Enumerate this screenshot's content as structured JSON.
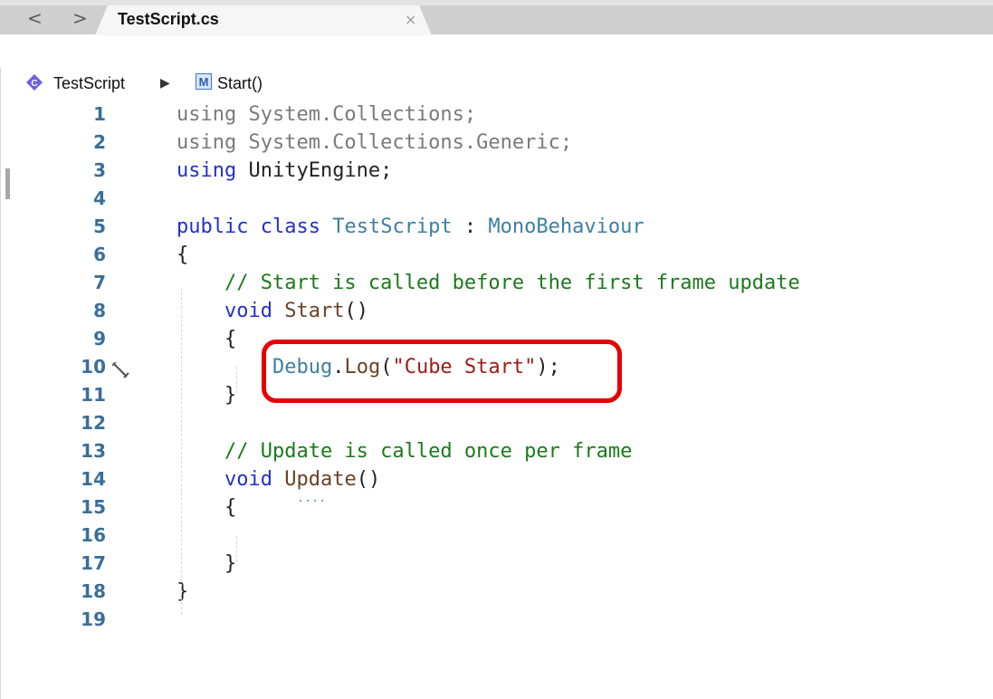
{
  "navigation": {
    "back_glyph": "<",
    "forward_glyph": ">"
  },
  "tab": {
    "title": "TestScript.cs",
    "close_glyph": "×"
  },
  "breadcrumb": {
    "class_name": "TestScript",
    "separator": "▶",
    "method_badge": "M",
    "method_name": "Start()",
    "class_icon": "class-diamond-icon",
    "method_icon": "method-icon"
  },
  "editor": {
    "line_numbers": [
      "1",
      "2",
      "3",
      "4",
      "5",
      "6",
      "7",
      "8",
      "9",
      "10",
      "11",
      "12",
      "13",
      "14",
      "15",
      "16",
      "17",
      "18",
      "19"
    ],
    "lines": [
      [
        {
          "t": "using System.Collections;",
          "c": "us"
        }
      ],
      [
        {
          "t": "using System.Collections.Generic;",
          "c": "us"
        }
      ],
      [
        {
          "t": "using",
          "c": "kw"
        },
        {
          "t": " UnityEngine;",
          "c": ""
        }
      ],
      [],
      [
        {
          "t": "public",
          "c": "kw"
        },
        {
          "t": " ",
          "c": ""
        },
        {
          "t": "class",
          "c": "kw"
        },
        {
          "t": " ",
          "c": ""
        },
        {
          "t": "TestScript",
          "c": "cls"
        },
        {
          "t": " : ",
          "c": ""
        },
        {
          "t": "MonoBehaviour",
          "c": "cls"
        }
      ],
      [
        {
          "t": "{",
          "c": ""
        }
      ],
      [
        {
          "t": "    // Start is called before the first frame update",
          "c": "cm"
        }
      ],
      [
        {
          "t": "    ",
          "c": ""
        },
        {
          "t": "void",
          "c": "kw"
        },
        {
          "t": " ",
          "c": ""
        },
        {
          "t": "Start",
          "c": "fn"
        },
        {
          "t": "()",
          "c": ""
        }
      ],
      [
        {
          "t": "    {",
          "c": ""
        }
      ],
      [
        {
          "t": "        ",
          "c": ""
        },
        {
          "t": "Debug",
          "c": "cls"
        },
        {
          "t": ".",
          "c": ""
        },
        {
          "t": "Log",
          "c": "fn"
        },
        {
          "t": "(",
          "c": ""
        },
        {
          "t": "\"Cube Start\"",
          "c": "str"
        },
        {
          "t": ");",
          "c": ""
        }
      ],
      [
        {
          "t": "    }",
          "c": ""
        }
      ],
      [],
      [
        {
          "t": "    // Update is called once per frame",
          "c": "cm"
        }
      ],
      [
        {
          "t": "    ",
          "c": ""
        },
        {
          "t": "void",
          "c": "kw"
        },
        {
          "t": " ",
          "c": ""
        },
        {
          "t": "Update",
          "c": "fn"
        },
        {
          "t": "()",
          "c": ""
        }
      ],
      [
        {
          "t": "    {",
          "c": ""
        }
      ],
      [],
      [
        {
          "t": "    }",
          "c": ""
        }
      ],
      [
        {
          "t": "}",
          "c": ""
        }
      ],
      []
    ],
    "highlighted_line": "10",
    "breakpoint_icon": "edit-pencil-icon"
  },
  "colors": {
    "keyword": "#2330c9",
    "comment": "#1a7a1a",
    "string": "#a01a1a",
    "class": "#3d7fa1",
    "highlight_border": "#e60000",
    "line_number": "#3a6e99"
  }
}
